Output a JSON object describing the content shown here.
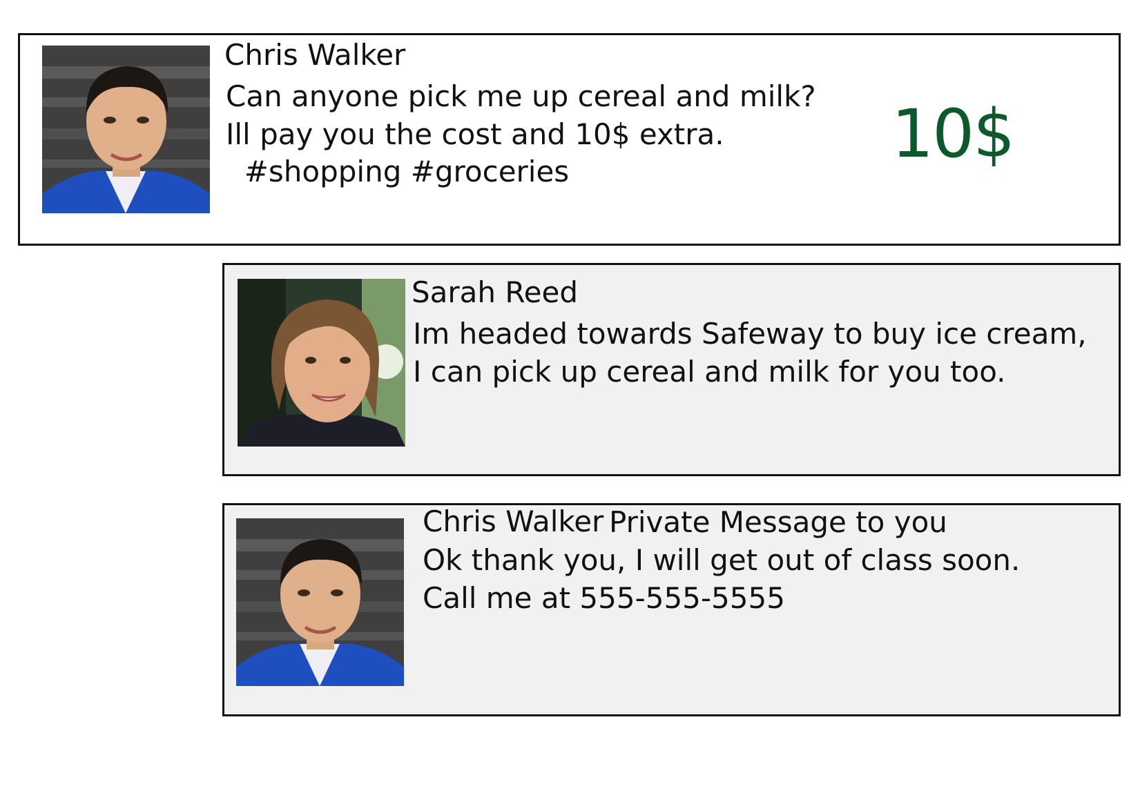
{
  "posts": [
    {
      "author": "Chris Walker",
      "lines": [
        "Can anyone pick me up cereal and milk?",
        "Ill pay you the cost and 10$ extra.",
        "  #shopping #groceries"
      ],
      "reward": "10$",
      "reward_color": "#0b5a2a",
      "avatar": "profile-photo-man"
    },
    {
      "author": "Sarah Reed",
      "lines": [
        "Im headed towards Safeway to buy ice cream,",
        "I can pick up cereal and milk for you too."
      ],
      "avatar": "profile-photo-woman"
    },
    {
      "author": "Chris Walker",
      "message_type": "Private Message to you",
      "lines": [
        "Ok thank you, I will get out of class soon.",
        "Call me at 555-555-5555"
      ],
      "avatar": "profile-photo-man"
    }
  ]
}
